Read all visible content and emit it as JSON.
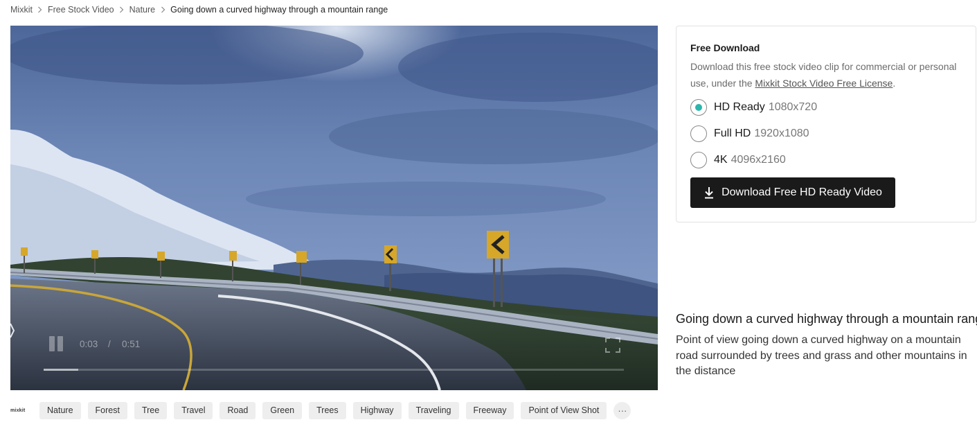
{
  "breadcrumb": {
    "items": [
      "Mixkit",
      "Free Stock Video",
      "Nature"
    ],
    "current": "Going down a curved highway through a mountain range",
    "separator": ">"
  },
  "player": {
    "current_time": "0:03",
    "time_separator": "/",
    "duration": "0:51",
    "progress_fraction": 0.06,
    "icons": [
      "pause-icon",
      "fullscreen-icon"
    ]
  },
  "tags": {
    "brand": "mixkit",
    "items": [
      "Nature",
      "Forest",
      "Tree",
      "Travel",
      "Road",
      "Green",
      "Trees",
      "Highway",
      "Traveling",
      "Freeway",
      "Point of View Shot"
    ],
    "more": "···"
  },
  "download": {
    "title": "Free Download",
    "desc_prefix": "Download this free stock video clip for commercial or personal use, under the ",
    "license_link": "Mixkit Stock Video Free License",
    "desc_suffix": ".",
    "options": [
      {
        "name": "HD Ready",
        "resolution": "1080x720",
        "selected": true
      },
      {
        "name": "Full HD",
        "resolution": "1920x1080",
        "selected": false
      },
      {
        "name": "4K",
        "resolution": "4096x2160",
        "selected": false
      }
    ],
    "button_label": "Download Free HD Ready Video",
    "accent_color": "#2bb6ad"
  },
  "video": {
    "title": "Going down a curved highway through a mountain range",
    "description": "Point of view going down a curved highway on a mountain road surrounded by trees and grass and other mountains in the distance"
  }
}
